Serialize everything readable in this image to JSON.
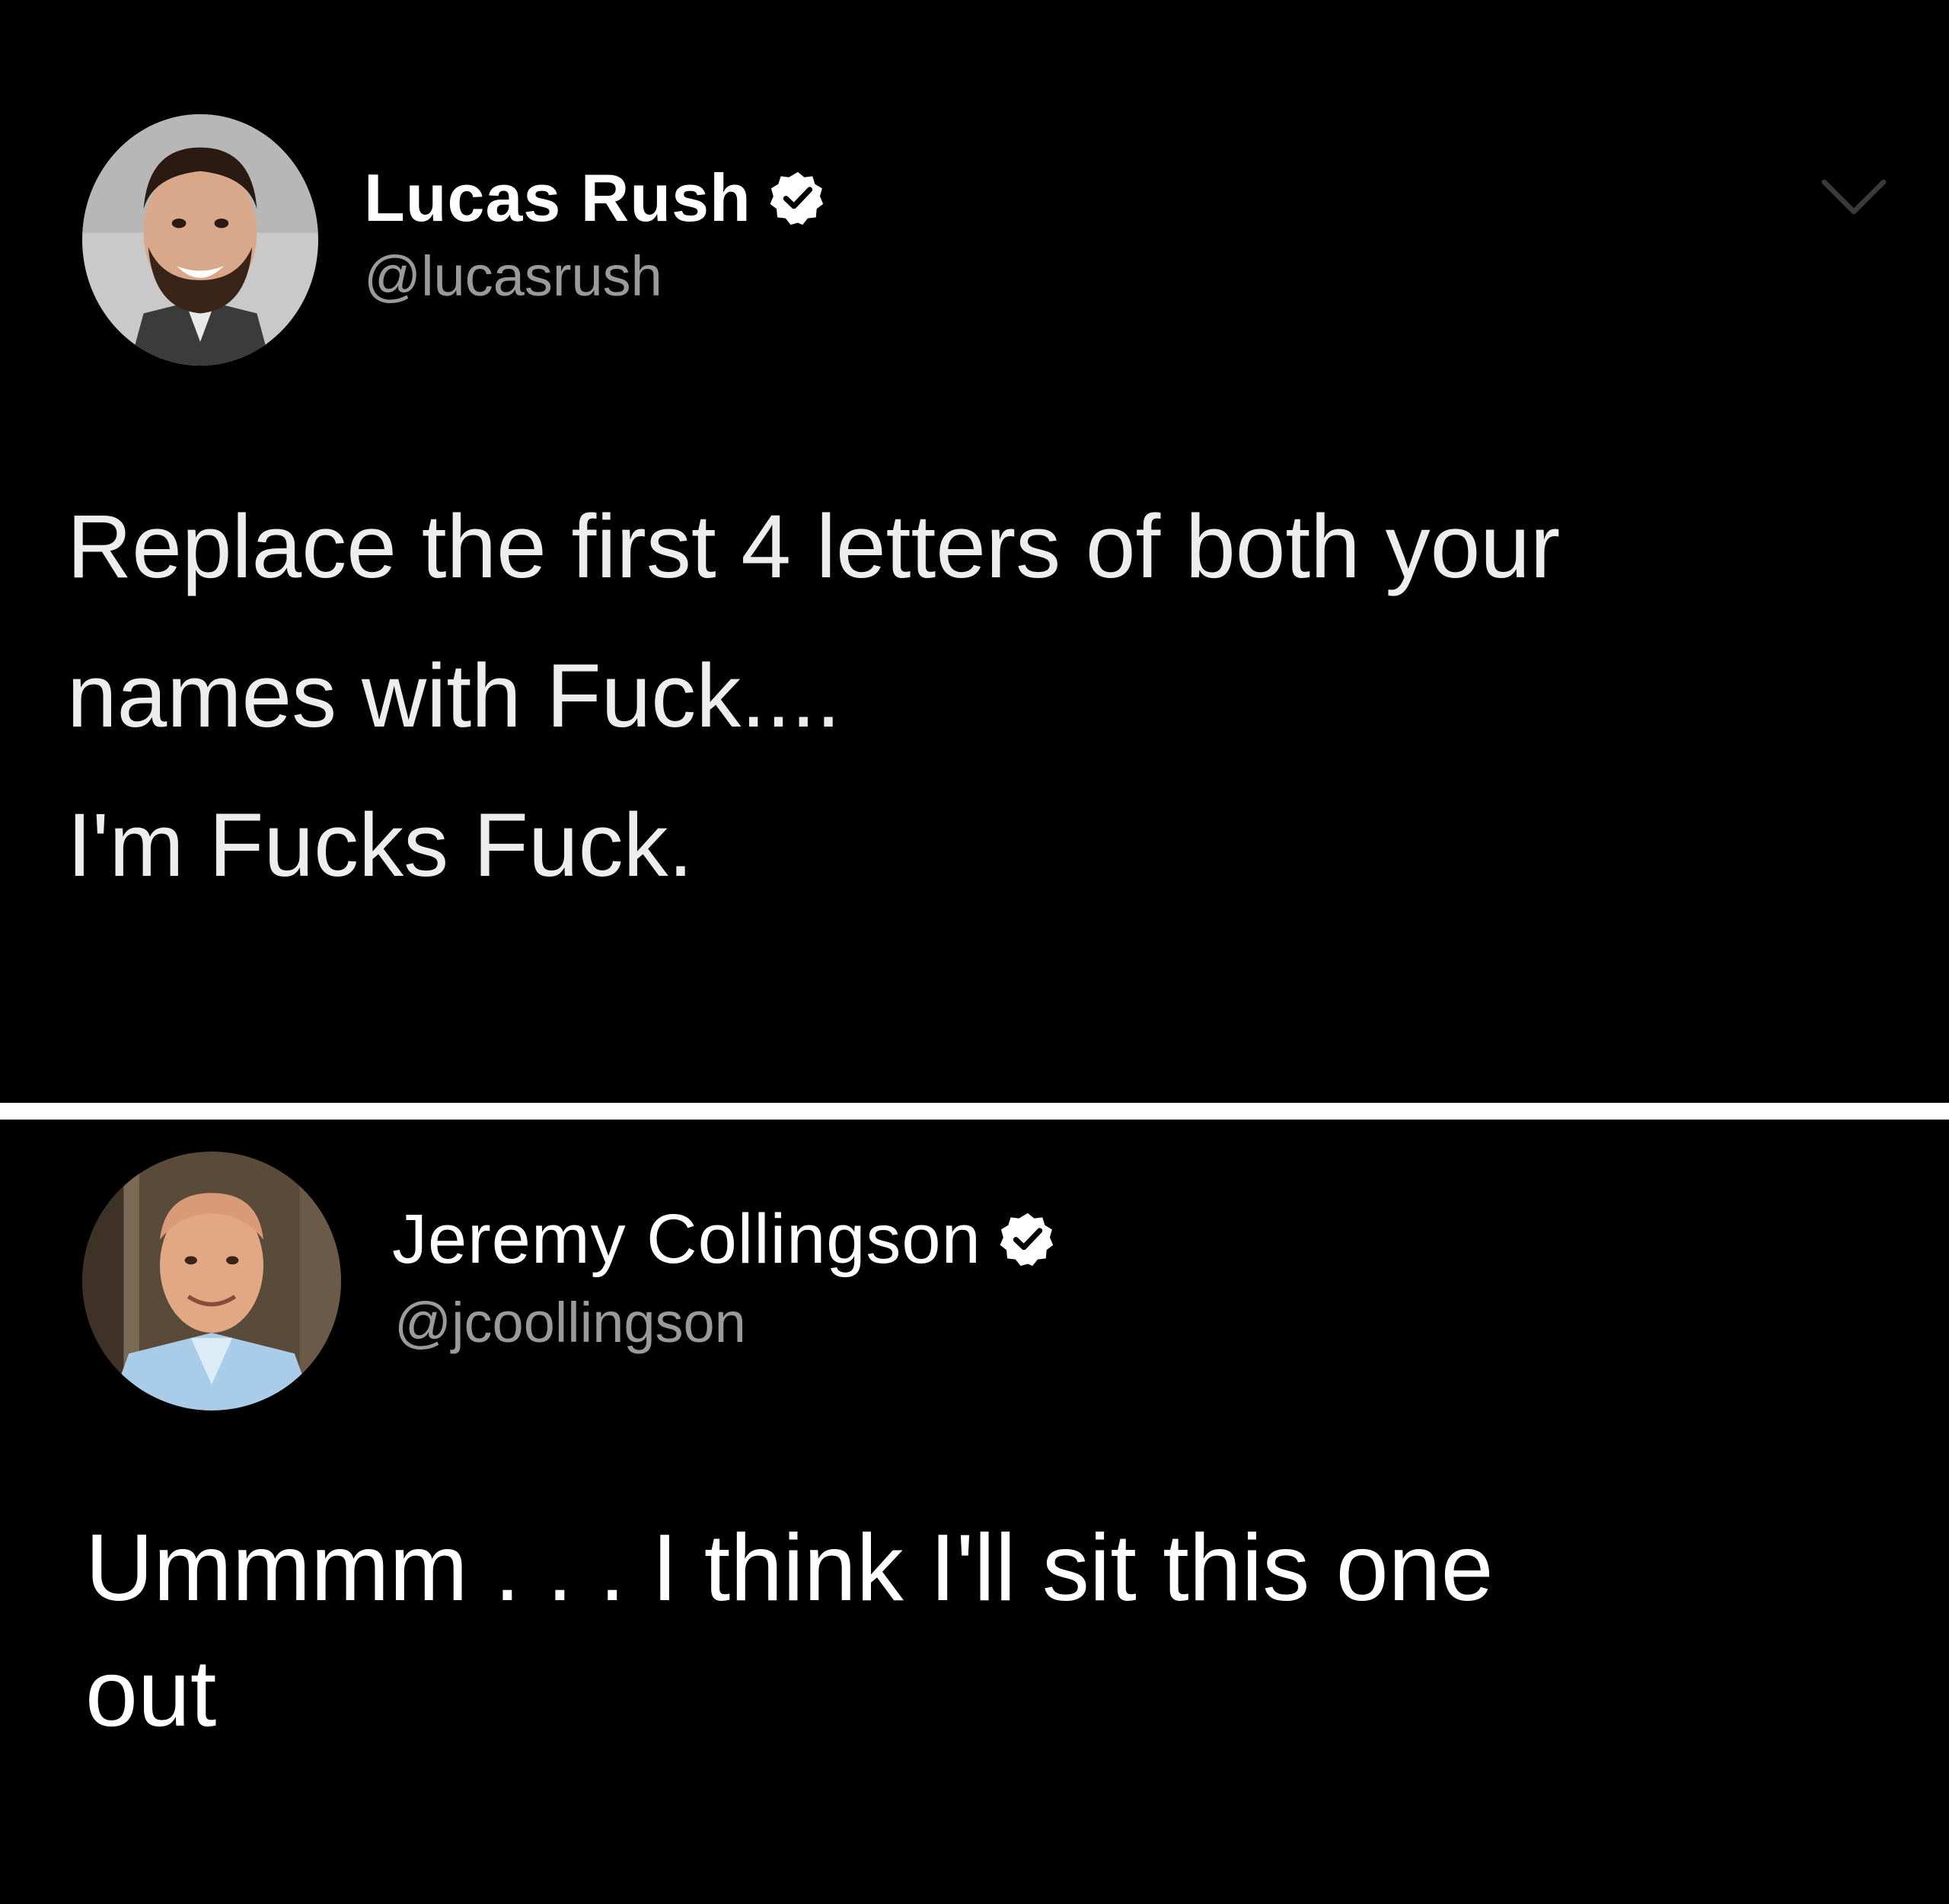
{
  "tweet_1": {
    "display_name": "Lucas Rush",
    "handle": "@lucasrush",
    "verified": true,
    "body_lines": [
      "Replace the first 4 letters of both your",
      "names with Fuck...."
    ],
    "body_paragraph_2": "I'm Fucks Fuck.",
    "menu_icon": "chevron-down-icon"
  },
  "tweet_2": {
    "display_name": "Jeremy Collingson",
    "handle": "@jcoollingson",
    "verified": true,
    "body_lines": [
      "Ummmm . . . I think I'll sit this one",
      "out"
    ]
  },
  "colors": {
    "background": "#000000",
    "name": "#ffffff",
    "handle": "#9a9a9a",
    "divider": "#ffffff",
    "verified_badge": "#ffffff"
  }
}
